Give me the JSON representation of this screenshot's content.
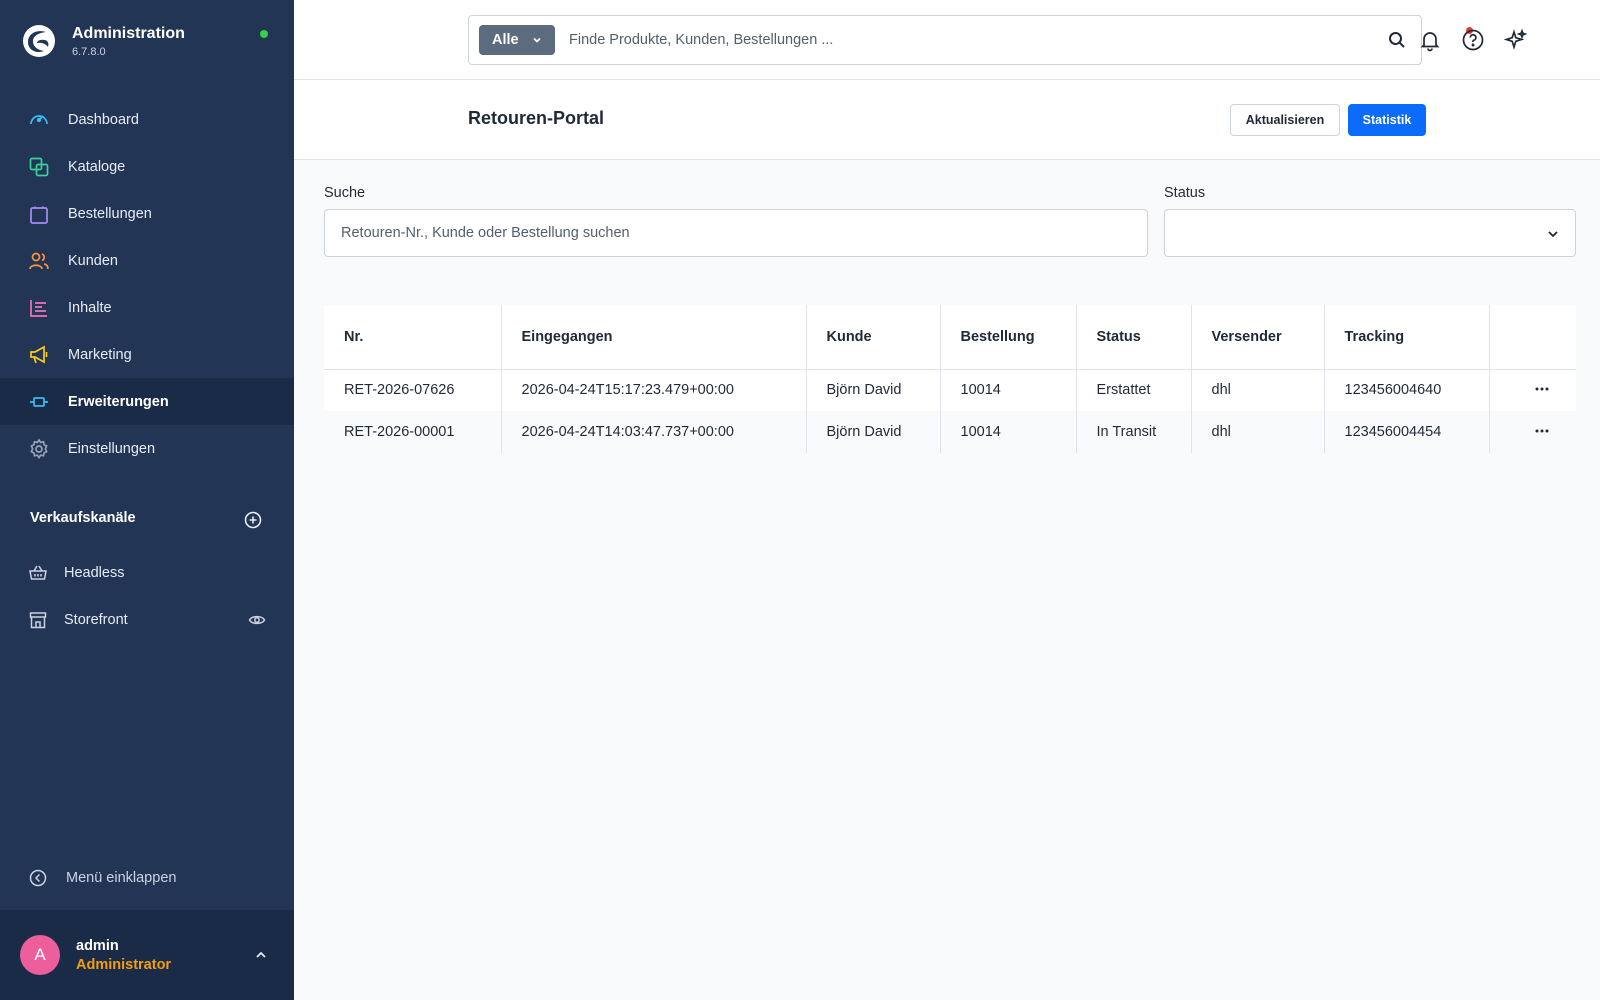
{
  "app": {
    "title": "Administration",
    "version": "6.7.8.0"
  },
  "sidebar": {
    "items": [
      {
        "label": "Dashboard",
        "icon": "dashboard-icon",
        "color": "#38bdf8"
      },
      {
        "label": "Kataloge",
        "icon": "catalog-icon",
        "color": "#34d399"
      },
      {
        "label": "Bestellungen",
        "icon": "shopping-bag-icon",
        "color": "#a78bfa"
      },
      {
        "label": "Kunden",
        "icon": "users-icon",
        "color": "#fb923c"
      },
      {
        "label": "Inhalte",
        "icon": "content-icon",
        "color": "#f472b6"
      },
      {
        "label": "Marketing",
        "icon": "megaphone-icon",
        "color": "#facc15"
      },
      {
        "label": "Erweiterungen",
        "icon": "plug-icon",
        "color": "#38bdf8",
        "active": true
      },
      {
        "label": "Einstellungen",
        "icon": "gear-icon",
        "color": "#94a3b8"
      }
    ],
    "channels_title": "Verkaufskanäle",
    "channels": [
      {
        "label": "Headless",
        "icon": "basket-icon"
      },
      {
        "label": "Storefront",
        "icon": "storefront-icon"
      }
    ],
    "collapse_label": "Menü einklappen"
  },
  "user": {
    "initial": "A",
    "name": "admin",
    "role": "Administrator"
  },
  "topbar": {
    "scope_label": "Alle",
    "search_placeholder": "Finde Produkte, Kunden, Bestellungen ..."
  },
  "page": {
    "title": "Retouren-Portal",
    "refresh_label": "Aktualisieren",
    "stats_label": "Statistik"
  },
  "filters": {
    "search_label": "Suche",
    "search_placeholder": "Retouren-Nr., Kunde oder Bestellung suchen",
    "status_label": "Status",
    "status_value": ""
  },
  "table": {
    "columns": [
      "Nr.",
      "Eingegangen",
      "Kunde",
      "Bestellung",
      "Status",
      "Versender",
      "Tracking"
    ],
    "rows": [
      {
        "nr": "RET-2026-07626",
        "received": "2026-04-24T15:17:23.479+00:00",
        "customer": "Björn David",
        "order": "10014",
        "status": "Erstattet",
        "carrier": "dhl",
        "tracking": "123456004640"
      },
      {
        "nr": "RET-2026-00001",
        "received": "2026-04-24T14:03:47.737+00:00",
        "customer": "Björn David",
        "order": "10014",
        "status": "In Transit",
        "carrier": "dhl",
        "tracking": "123456004454"
      }
    ]
  },
  "colors": {
    "sidebar": "#233554",
    "sidebar_active": "#192b47",
    "primary": "#0b6cfb",
    "online": "#37d046"
  }
}
